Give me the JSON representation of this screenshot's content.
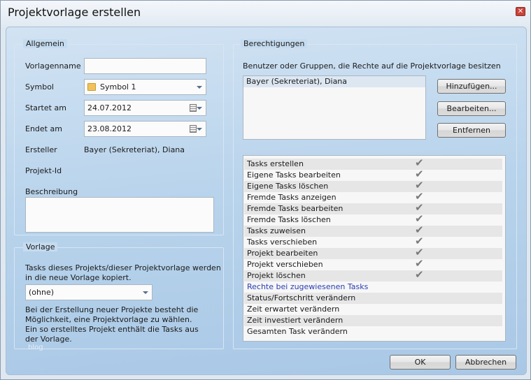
{
  "window": {
    "title": "Projektvorlage erstellen",
    "close_icon": "close-icon"
  },
  "allgemein": {
    "legend": "Allgemein",
    "vorlagenname_label": "Vorlagenname",
    "vorlagenname_value": "",
    "symbol_label": "Symbol",
    "symbol_value": "Symbol 1",
    "start_label": "Startet am",
    "start_value": "24.07.2012",
    "end_label": "Endet am",
    "end_value": "23.08.2012",
    "ersteller_label": "Ersteller",
    "ersteller_value": "Bayer (Sekreteriat), Diana",
    "projektid_label": "Projekt-Id",
    "beschreibung_label": "Beschreibung",
    "beschreibung_value": ""
  },
  "vorlage": {
    "legend": "Vorlage",
    "info1": "Tasks dieses Projekts/dieser Projektvorlage werden in die neue Vorlage kopiert.",
    "select_value": "(ohne)",
    "info2": "Bei der Erstellung neuer Projekte besteht die Möglichkeit, eine Projektvorlage zu wählen. Ein so erstelltes Projekt enthält die Tasks aus der Vorlage.",
    "watermark": "blog"
  },
  "berechtigungen": {
    "legend": "Berechtigungen",
    "users_label": "Benutzer oder Gruppen, die Rechte auf die Projektvorlage besitzen",
    "users": [
      "Bayer (Sekreteriat), Diana"
    ],
    "add_button": "Hinzufügen...",
    "edit_button": "Bearbeiten...",
    "remove_button": "Entfernen",
    "rights": [
      {
        "label": "Tasks erstellen",
        "checked": true
      },
      {
        "label": "Eigene Tasks bearbeiten",
        "checked": true
      },
      {
        "label": "Eigene Tasks löschen",
        "checked": true
      },
      {
        "label": "Fremde Tasks anzeigen",
        "checked": true
      },
      {
        "label": "Fremde Tasks bearbeiten",
        "checked": true
      },
      {
        "label": "Fremde Tasks löschen",
        "checked": true
      },
      {
        "label": "Tasks zuweisen",
        "checked": true
      },
      {
        "label": "Tasks verschieben",
        "checked": true
      },
      {
        "label": "Projekt bearbeiten",
        "checked": true
      },
      {
        "label": "Projekt verschieben",
        "checked": true
      },
      {
        "label": "Projekt löschen",
        "checked": true
      },
      {
        "label": "Rechte bei zugewiesenen Tasks",
        "checked": false,
        "header": true
      },
      {
        "label": "Status/Fortschritt verändern",
        "checked": false
      },
      {
        "label": "Zeit erwartet verändern",
        "checked": false
      },
      {
        "label": "Zeit investiert verändern",
        "checked": false
      },
      {
        "label": "Gesamten Task verändern",
        "checked": false
      }
    ]
  },
  "footer": {
    "ok": "OK",
    "cancel": "Abbrechen"
  }
}
